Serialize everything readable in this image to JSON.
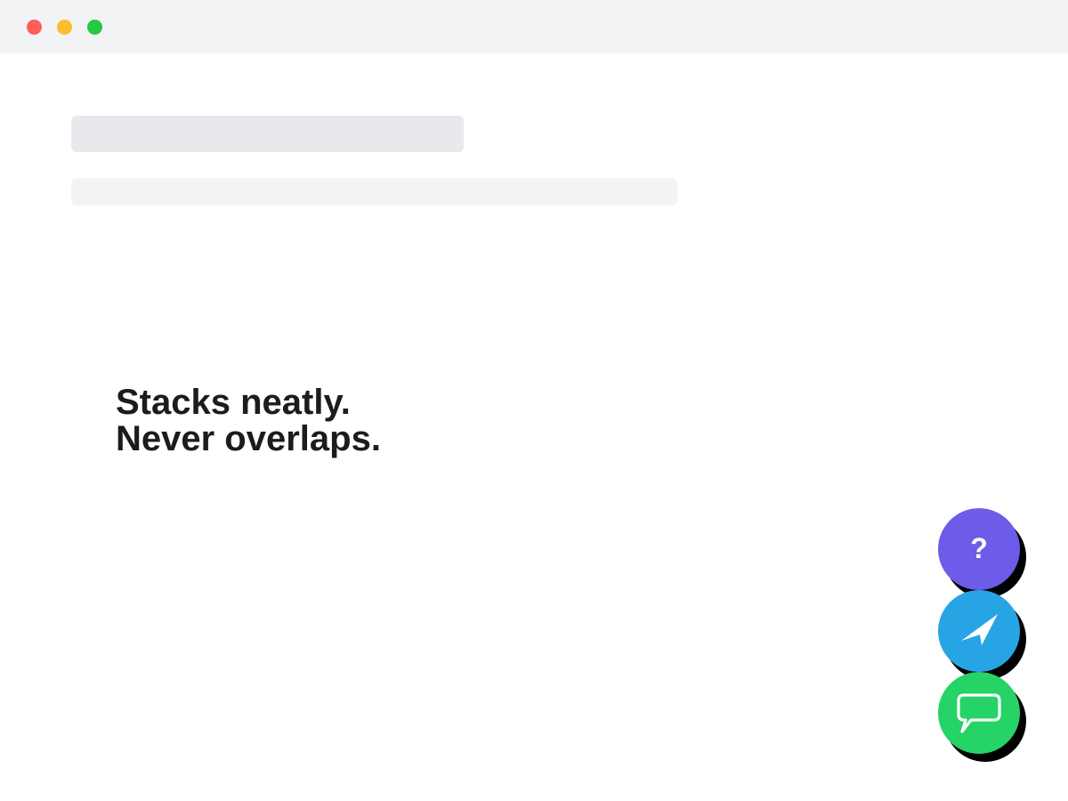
{
  "window": {
    "controls": {
      "close_color": "#ff5f57",
      "minimize_color": "#febc2e",
      "maximize_color": "#28c840"
    }
  },
  "headline": {
    "line1": "Stacks neatly.",
    "line2": "Never overlaps."
  },
  "fabs": [
    {
      "name": "help",
      "icon": "question-mark-icon",
      "glyph": "?",
      "color": "#6c5ce7"
    },
    {
      "name": "send",
      "icon": "paper-plane-icon",
      "color": "#27a4e3"
    },
    {
      "name": "chat",
      "icon": "speech-bubble-icon",
      "color": "#25d366"
    }
  ]
}
